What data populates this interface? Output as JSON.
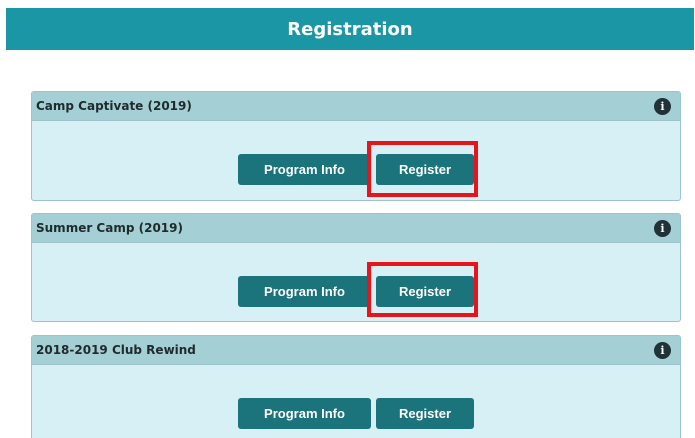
{
  "header": {
    "title": "Registration"
  },
  "cards": [
    {
      "title": "Camp Captivate (2019)",
      "info_icon": "i",
      "program_info_label": "Program Info",
      "register_label": "Register"
    },
    {
      "title": "Summer Camp (2019)",
      "info_icon": "i",
      "program_info_label": "Program Info",
      "register_label": "Register"
    },
    {
      "title": "2018-2019 Club Rewind",
      "info_icon": "i",
      "program_info_label": "Program Info",
      "register_label": "Register"
    }
  ],
  "colors": {
    "header_bg": "#1a96a4",
    "card_header_bg": "#a4cfd4",
    "card_body_bg": "#d7f0f5",
    "button_bg": "#1b737b",
    "highlight": "#e8141c"
  },
  "icons": {
    "info": "info-icon"
  }
}
